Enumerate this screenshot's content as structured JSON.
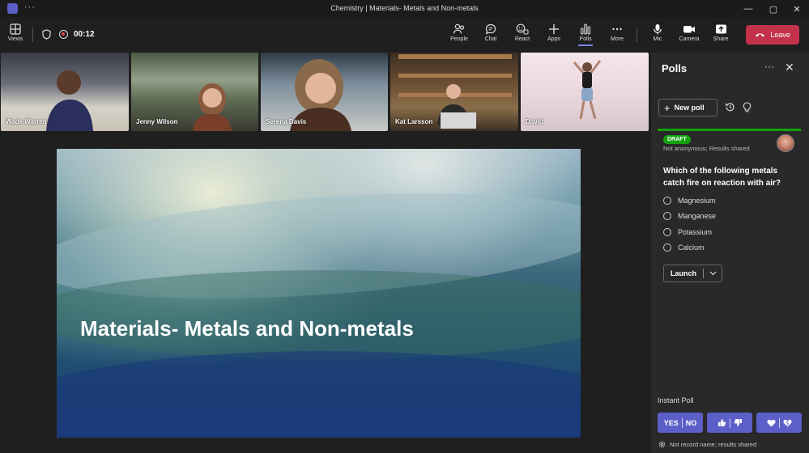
{
  "window": {
    "title": "Chemistry | Materials- Metals and Non-metals",
    "more_icon": "more-horizontal-icon",
    "controls": [
      "minimize-icon",
      "maximize-icon",
      "close-icon"
    ]
  },
  "toolbar": {
    "views_label": "Views",
    "timer": "00:12",
    "items": [
      {
        "label": "People",
        "icon": "people-icon"
      },
      {
        "label": "Chat",
        "icon": "chat-icon"
      },
      {
        "label": "React",
        "icon": "react-icon"
      },
      {
        "label": "Apps",
        "icon": "apps-icon"
      },
      {
        "label": "Polls",
        "icon": "polls-icon",
        "active": true
      },
      {
        "label": "More",
        "icon": "more-icon"
      },
      {
        "label": "Mic",
        "icon": "mic-icon"
      },
      {
        "label": "Camera",
        "icon": "camera-icon"
      },
      {
        "label": "Share",
        "icon": "share-icon"
      }
    ],
    "leave_label": "Leave",
    "colors": {
      "leave": "#c4314b",
      "accent": "#7f85f5"
    }
  },
  "participants": [
    {
      "name": "Wade Warren"
    },
    {
      "name": "Jenny Wilson"
    },
    {
      "name": "Serena Davis"
    },
    {
      "name": "Kat Larsson"
    },
    {
      "name": "David"
    }
  ],
  "slide": {
    "heading": "Materials- Metals and Non-metals"
  },
  "polls": {
    "title": "Polls",
    "new_poll_label": "New poll",
    "status_badge": "DRAFT",
    "meta": "Not anonymous; Results shared",
    "question": "Which of the following metals catch fire on reaction with air?",
    "options": [
      "Magnesium",
      "Manganese",
      "Potassium",
      "Calcium"
    ],
    "launch_label": "Launch",
    "instant_poll_label": "Instant Poll",
    "instant_buttons": [
      {
        "label_left": "YES",
        "label_right": "NO"
      },
      {
        "icon_left": "thumbs-up-icon",
        "icon_right": "thumbs-down-icon"
      },
      {
        "icon_left": "heart-icon",
        "icon_right": "heart-broken-icon"
      }
    ],
    "footer_note": "Not record name; results shared",
    "colors": {
      "draft": "#13a10e",
      "instant_button": "#5b5fc7"
    }
  }
}
